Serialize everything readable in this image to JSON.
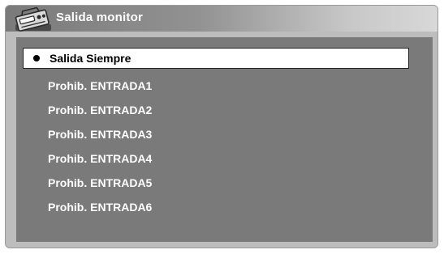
{
  "window": {
    "title": "Salida monitor",
    "icon": "monitor-output-icon"
  },
  "menu": {
    "items": [
      {
        "label": "Salida Siempre",
        "selected": true
      },
      {
        "label": "Prohib. ENTRADA1",
        "selected": false
      },
      {
        "label": "Prohib. ENTRADA2",
        "selected": false
      },
      {
        "label": "Prohib. ENTRADA3",
        "selected": false
      },
      {
        "label": "Prohib. ENTRADA4",
        "selected": false
      },
      {
        "label": "Prohib. ENTRADA5",
        "selected": false
      },
      {
        "label": "Prohib. ENTRADA6",
        "selected": false
      }
    ]
  },
  "colors": {
    "frame_background": "#bdbdbd",
    "panel_background": "#7a7a7a",
    "selected_background": "#ffffff",
    "item_text": "#ffffff",
    "selected_text": "#000000"
  }
}
